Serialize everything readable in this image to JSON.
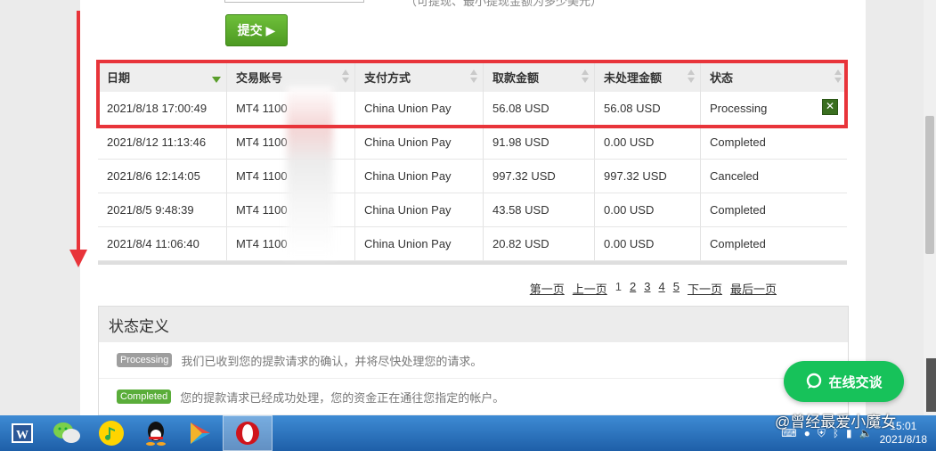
{
  "form": {
    "hint_text": "（可提现、最小提现金额为多少美元）",
    "submit_label": "提交 ▶"
  },
  "table": {
    "columns": [
      "日期",
      "交易账号",
      "支付方式",
      "取款金额",
      "未处理金额",
      "状态"
    ],
    "rows": [
      [
        "2021/8/18 17:00:49",
        "MT4 1100",
        "China Union Pay",
        "56.08 USD",
        "56.08 USD",
        "Processing"
      ],
      [
        "2021/8/12 11:13:46",
        "MT4 1100",
        "China Union Pay",
        "91.98 USD",
        "0.00 USD",
        "Completed"
      ],
      [
        "2021/8/6 12:14:05",
        "MT4 1100",
        "China Union Pay",
        "997.32 USD",
        "997.32 USD",
        "Canceled"
      ],
      [
        "2021/8/5 9:48:39",
        "MT4 1100",
        "China Union Pay",
        "43.58 USD",
        "0.00 USD",
        "Completed"
      ],
      [
        "2021/8/4 11:06:40",
        "MT4 1100",
        "China Union Pay",
        "20.82 USD",
        "0.00 USD",
        "Completed"
      ]
    ]
  },
  "pagination": {
    "first": "第一页",
    "prev": "上一页",
    "pages": [
      "1",
      "2",
      "3",
      "4",
      "5"
    ],
    "current": "1",
    "next": "下一页",
    "last": "最后一页"
  },
  "status_panel": {
    "title": "状态定义",
    "items": [
      {
        "badge": "Processing",
        "text": "我们已收到您的提款请求的确认，并将尽快处理您的请求。"
      },
      {
        "badge": "Completed",
        "text": "您的提款请求已经成功处理，您的资金正在通往您指定的帐户。"
      }
    ]
  },
  "chat": {
    "label": "在线交谈"
  },
  "taskbar": {
    "apps": [
      "word-icon",
      "wechat-icon",
      "qq-music-icon",
      "qq-icon",
      "play-store-icon",
      "opera-icon"
    ],
    "time": "15:01",
    "date": "2021/8/18"
  },
  "watermark": "@曾经最爱小魔女",
  "colors": {
    "highlight": "#e8343a",
    "green": "#5aad3a",
    "chat": "#17c25a",
    "taskbar": "#2a73c2"
  }
}
